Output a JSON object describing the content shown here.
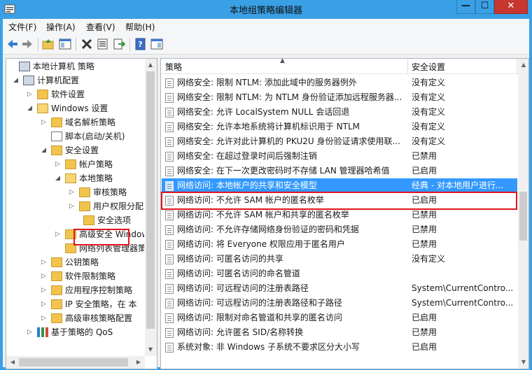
{
  "window": {
    "title": "本地组策略编辑器",
    "min_glyph": "—",
    "max_glyph": "☐",
    "close_glyph": "✕"
  },
  "menu": [
    {
      "label": "文件(F)"
    },
    {
      "label": "操作(A)"
    },
    {
      "label": "查看(V)"
    },
    {
      "label": "帮助(H)"
    }
  ],
  "toolbar": [
    "back-icon",
    "forward-icon",
    "up-folder-icon",
    "show-hide-tree-icon",
    "delete-icon",
    "properties-icon",
    "export-icon",
    "help-icon",
    "show-pane-icon"
  ],
  "tree": [
    {
      "label": "本地计算机 策略",
      "icon": "computer-policy-icon",
      "exp": ""
    },
    {
      "label": "计算机配置",
      "icon": "computer-icon",
      "exp": "◢"
    },
    {
      "label": "软件设置",
      "icon": "folder-icon",
      "exp": "▷"
    },
    {
      "label": "Windows 设置",
      "icon": "folder-open-icon",
      "exp": "◢"
    },
    {
      "label": "域名解析策略",
      "icon": "folder-icon",
      "exp": "▷"
    },
    {
      "label": "脚本(启动/关机)",
      "icon": "script-icon",
      "exp": ""
    },
    {
      "label": "安全设置",
      "icon": "security-icon",
      "exp": "◢"
    },
    {
      "label": "帐户策略",
      "icon": "folder-icon",
      "exp": "▷"
    },
    {
      "label": "本地策略",
      "icon": "folder-open-icon",
      "exp": "◢"
    },
    {
      "label": "审核策略",
      "icon": "folder-icon",
      "exp": "▷"
    },
    {
      "label": "用户权限分配",
      "icon": "folder-icon",
      "exp": "▷"
    },
    {
      "label": "安全选项",
      "icon": "folder-icon",
      "exp": ""
    },
    {
      "label": "高级安全 Window",
      "icon": "folder-icon",
      "exp": "▷"
    },
    {
      "label": "网络列表管理器策",
      "icon": "folder-icon",
      "exp": ""
    },
    {
      "label": "公钥策略",
      "icon": "folder-icon",
      "exp": "▷"
    },
    {
      "label": "软件限制策略",
      "icon": "folder-icon",
      "exp": "▷"
    },
    {
      "label": "应用程序控制策略",
      "icon": "folder-icon",
      "exp": "▷"
    },
    {
      "label": "IP 安全策略，在 本",
      "icon": "ip-security-icon",
      "exp": "▷"
    },
    {
      "label": "高级审核策略配置",
      "icon": "folder-icon",
      "exp": "▷"
    },
    {
      "label": "基于策略的 QoS",
      "icon": "chart-icon",
      "exp": "▷"
    }
  ],
  "list": {
    "col_policy": "策略",
    "col_setting": "安全设置",
    "rows": [
      {
        "name": "网络安全: 限制 NTLM: 添加此域中的服务器例外",
        "value": "没有定义"
      },
      {
        "name": "网络安全: 限制 NTLM: 为 NTLM 身份验证添加远程服务器...",
        "value": "没有定义"
      },
      {
        "name": "网络安全: 允许 LocalSystem NULL 会话回退",
        "value": "没有定义"
      },
      {
        "name": "网络安全: 允许本地系统将计算机标识用于 NTLM",
        "value": "没有定义"
      },
      {
        "name": "网络安全: 允许对此计算机的 PKU2U 身份验证请求使用联...",
        "value": "没有定义"
      },
      {
        "name": "网络安全: 在超过登录时间后强制注销",
        "value": "已禁用"
      },
      {
        "name": "网络安全: 在下一次更改密码时不存储 LAN 管理器哈希值",
        "value": "已启用"
      },
      {
        "name": "网络访问: 本地帐户的共享和安全模型",
        "value": "经典 - 对本地用户进行..."
      },
      {
        "name": "网络访问: 不允许 SAM 帐户的匿名枚举",
        "value": "已启用"
      },
      {
        "name": "网络访问: 不允许 SAM 帐户和共享的匿名枚举",
        "value": "已禁用"
      },
      {
        "name": "网络访问: 不允许存储网络身份验证的密码和凭据",
        "value": "已禁用"
      },
      {
        "name": "网络访问: 将 Everyone 权限应用于匿名用户",
        "value": "已禁用"
      },
      {
        "name": "网络访问: 可匿名访问的共享",
        "value": "没有定义"
      },
      {
        "name": "网络访问: 可匿名访问的命名管道",
        "value": ""
      },
      {
        "name": "网络访问: 可远程访问的注册表路径",
        "value": "System\\CurrentContro..."
      },
      {
        "name": "网络访问: 可远程访问的注册表路径和子路径",
        "value": "System\\CurrentContro..."
      },
      {
        "name": "网络访问: 限制对命名管道和共享的匿名访问",
        "value": "已启用"
      },
      {
        "name": "网络访问: 允许匿名 SID/名称转换",
        "value": "已禁用"
      },
      {
        "name": "系统对象: 非 Windows 子系统不要求区分大小写",
        "value": "已启用"
      }
    ]
  },
  "colors": {
    "title_bar": "#3aa0e6",
    "selection": "#3399ff",
    "highlight_box": "#e0141b"
  }
}
